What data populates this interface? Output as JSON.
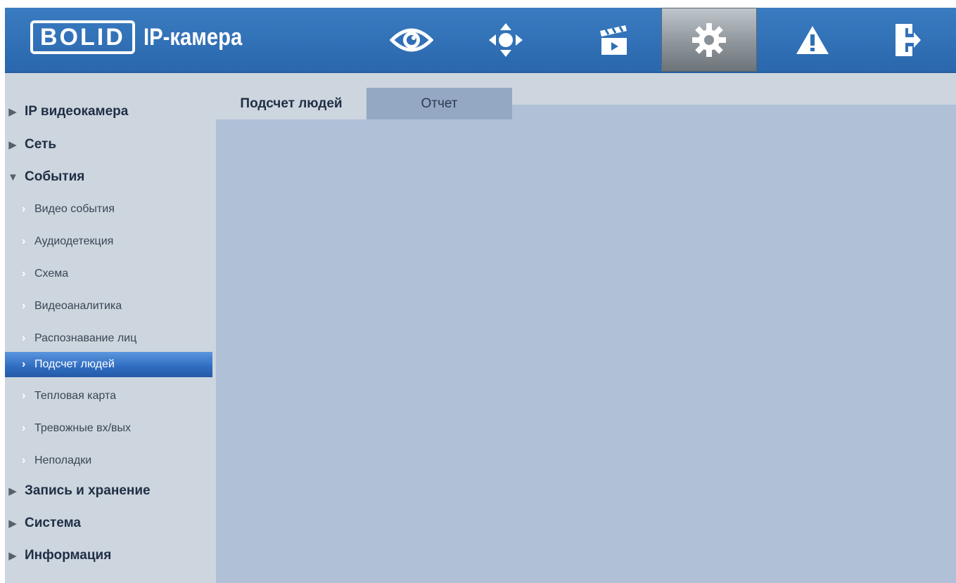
{
  "header": {
    "logo_text": "BOLID",
    "app_title": "IP-камера",
    "nav": [
      {
        "icon": "eye-icon",
        "name": "live-view"
      },
      {
        "icon": "ptz-arrows-icon",
        "name": "ptz"
      },
      {
        "icon": "clapperboard-icon",
        "name": "playback"
      },
      {
        "icon": "gear-icon",
        "name": "settings",
        "active": true
      },
      {
        "icon": "warning-icon",
        "name": "alarm"
      },
      {
        "icon": "exit-icon",
        "name": "logout"
      }
    ]
  },
  "sidebar": {
    "groups": [
      {
        "label": "IP видеокамера",
        "expanded": false
      },
      {
        "label": "Сеть",
        "expanded": false
      },
      {
        "label": "События",
        "expanded": true
      },
      {
        "label": "Запись и хранение",
        "expanded": false
      },
      {
        "label": "Система",
        "expanded": false
      },
      {
        "label": "Информация",
        "expanded": false
      }
    ],
    "event_items": [
      {
        "label": "Видео события"
      },
      {
        "label": "Аудиодетекция"
      },
      {
        "label": "Схема"
      },
      {
        "label": "Видеоаналитика"
      },
      {
        "label": "Распознавание лиц"
      },
      {
        "label": "Подсчет людей",
        "selected": true
      },
      {
        "label": "Тепловая карта"
      },
      {
        "label": "Тревожные вх/вых"
      },
      {
        "label": "Неполадки"
      }
    ]
  },
  "main": {
    "tabs": [
      {
        "label": "Подсчет людей",
        "active": true
      },
      {
        "label": "Отчет",
        "active": false
      }
    ]
  },
  "colors": {
    "header": "#2f6fb4",
    "sidebar": "#cdd5de",
    "content": "#b0c0d7",
    "selected": "#2f6cc0"
  }
}
